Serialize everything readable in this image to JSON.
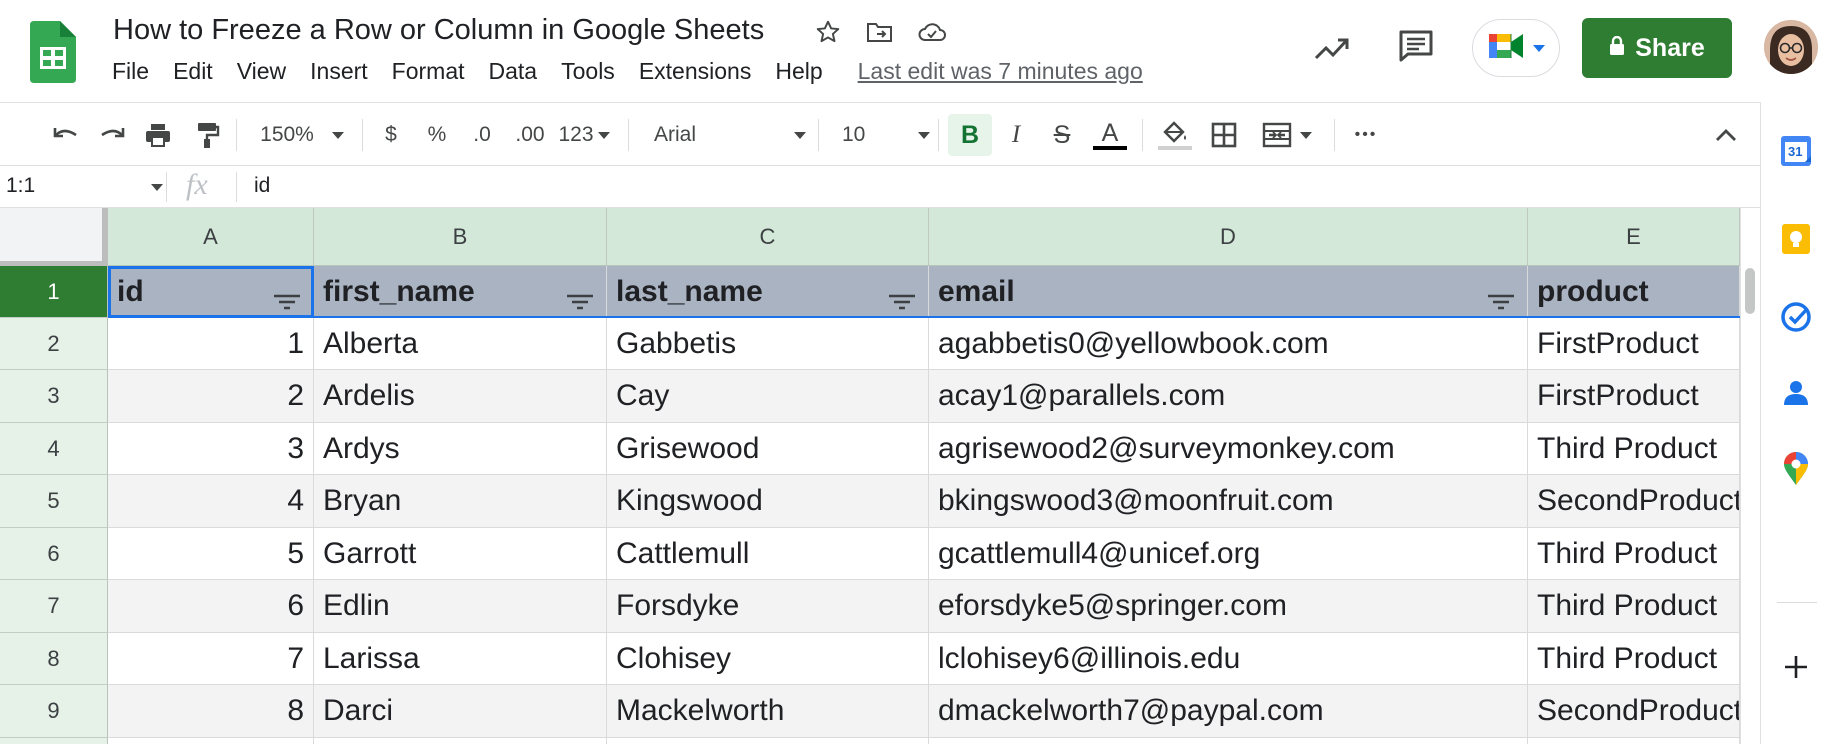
{
  "document": {
    "title": "How to Freeze a Row or Column in Google Sheets",
    "last_edit": "Last edit was 7 minutes ago"
  },
  "menu": [
    "File",
    "Edit",
    "View",
    "Insert",
    "Format",
    "Data",
    "Tools",
    "Extensions",
    "Help"
  ],
  "share": {
    "label": "Share"
  },
  "toolbar": {
    "zoom": "150%",
    "currency": "$",
    "percent": "%",
    "decrease_decimal": ".0",
    "increase_decimal": ".00",
    "more_formats": "123",
    "font": "Arial",
    "font_size": "10",
    "bold": "B",
    "italic": "I",
    "strikethrough": "S",
    "text_color": "A",
    "more": "•••"
  },
  "formula_bar": {
    "name_box": "1:1",
    "fx": "fx",
    "value": "id"
  },
  "sheet": {
    "columns": [
      "A",
      "B",
      "C",
      "D",
      "E"
    ],
    "row_numbers": [
      "1",
      "2",
      "3",
      "4",
      "5",
      "6",
      "7",
      "8",
      "9"
    ],
    "header": [
      "id",
      "first_name",
      "last_name",
      "email",
      "product"
    ],
    "rows": [
      [
        "1",
        "Alberta",
        "Gabbetis",
        "agabbetis0@yellowbook.com",
        "FirstProduct"
      ],
      [
        "2",
        "Ardelis",
        "Cay",
        "acay1@parallels.com",
        "FirstProduct"
      ],
      [
        "3",
        "Ardys",
        "Grisewood",
        "agrisewood2@surveymonkey.com",
        "Third Product"
      ],
      [
        "4",
        "Bryan",
        "Kingswood",
        "bkingswood3@moonfruit.com",
        "SecondProduct"
      ],
      [
        "5",
        "Garrott",
        "Cattlemull",
        "gcattlemull4@unicef.org",
        "Third Product"
      ],
      [
        "6",
        "Edlin",
        "Forsdyke",
        "eforsdyke5@springer.com",
        "Third Product"
      ],
      [
        "7",
        "Larissa",
        "Clohisey",
        "lclohisey6@illinois.edu",
        "Third Product"
      ],
      [
        "8",
        "Darci",
        "Mackelworth",
        "dmackelworth7@paypal.com",
        "SecondProduct"
      ]
    ]
  },
  "side_panel": {
    "calendar_day": "31"
  },
  "colors": {
    "share": "#2e7d32",
    "header_row": "#a9b3c2",
    "column_header": "#d3e8d9",
    "selection": "#1a73e8"
  }
}
